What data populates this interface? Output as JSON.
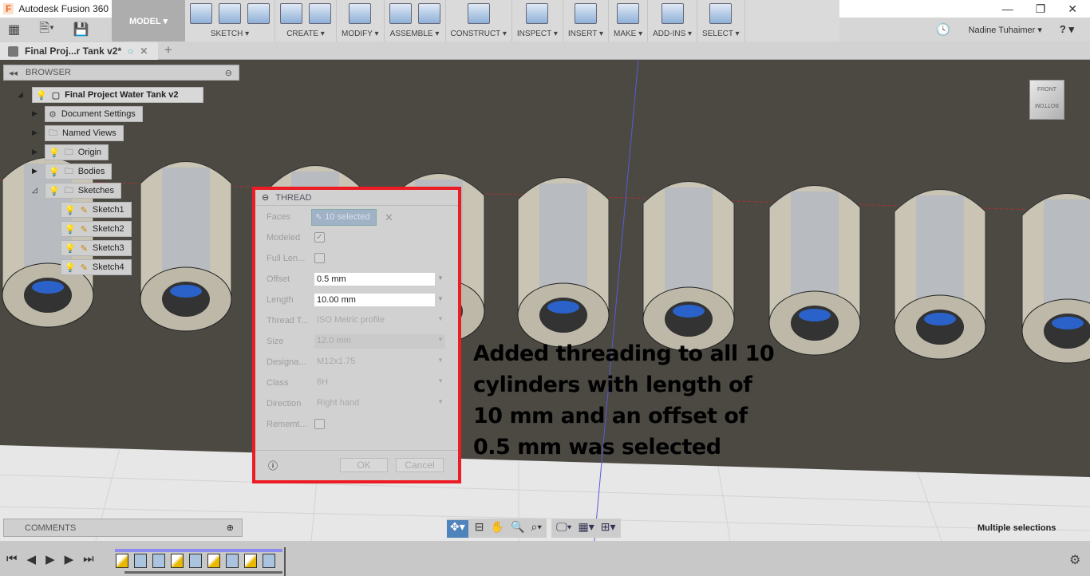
{
  "window": {
    "title": "Autodesk Fusion 360",
    "minimize": "—",
    "restore": "❐",
    "close": "✕"
  },
  "workspace": {
    "label": "MODEL ▾"
  },
  "ribbon": [
    {
      "label": "SKETCH ▾",
      "icons": [
        "create-sketch-icon",
        "arc-icon",
        "rectangle-icon"
      ]
    },
    {
      "label": "CREATE ▾",
      "icons": [
        "extrude-icon",
        "create-form-icon"
      ]
    },
    {
      "label": "MODIFY ▾",
      "icons": [
        "press-pull-icon"
      ]
    },
    {
      "label": "ASSEMBLE ▾",
      "icons": [
        "new-component-icon",
        "joint-icon"
      ]
    },
    {
      "label": "CONSTRUCT ▾",
      "icons": [
        "offset-plane-icon"
      ]
    },
    {
      "label": "INSPECT ▾",
      "icons": [
        "measure-icon"
      ]
    },
    {
      "label": "INSERT ▾",
      "icons": [
        "insert-image-icon"
      ]
    },
    {
      "label": "MAKE ▾",
      "icons": [
        "3d-print-icon"
      ]
    },
    {
      "label": "ADD-INS ▾",
      "icons": [
        "scripts-icon"
      ]
    },
    {
      "label": "SELECT ▾",
      "icons": [
        "select-box-icon"
      ]
    }
  ],
  "user": {
    "name": "Nadine Tuhaimer ▾",
    "help": "? ▾"
  },
  "doc_tab": {
    "label": "Final Proj...r Tank v2*",
    "new_tab": "+"
  },
  "browser": {
    "title": "BROWSER",
    "root": "Final Project Water Tank v2",
    "items": [
      "Document Settings",
      "Named Views",
      "Origin",
      "Bodies",
      "Sketches"
    ],
    "sketches": [
      "Sketch1",
      "Sketch2",
      "Sketch3",
      "Sketch4"
    ]
  },
  "thread_dialog": {
    "title": "THREAD",
    "faces_label": "Faces",
    "faces_value": "10 selected",
    "modeled_label": "Modeled",
    "modeled_checked": true,
    "full_length_label": "Full Len...",
    "full_length_checked": false,
    "offset_label": "Offset",
    "offset_value": "0.5 mm",
    "length_label": "Length",
    "length_value": "10.00 mm",
    "thread_type_label": "Thread T...",
    "thread_type_value": "ISO Metric profile",
    "size_label": "Size",
    "size_value": "12.0 mm",
    "designation_label": "Designa...",
    "designation_value": "M12x1.75",
    "class_label": "Class",
    "class_value": "6H",
    "direction_label": "Direction",
    "direction_value": "Right hand",
    "remember_label": "Rememt...",
    "remember_checked": false,
    "ok": "OK",
    "cancel": "Cancel"
  },
  "annotation": [
    "Added threading to all 10",
    "cylinders with length of",
    "10 mm and an offset of",
    "0.5 mm was selected"
  ],
  "viewcube": {
    "front": "FRONT",
    "bottom": "BOTTOM"
  },
  "comments": {
    "title": "COMMENTS"
  },
  "status": "Multiple selections",
  "colors": {
    "highlight_border": "#ec1c24",
    "viewport_bg": "#4b4942",
    "floor": "#e6e6e6",
    "selected_blue": "#4f83bb"
  }
}
